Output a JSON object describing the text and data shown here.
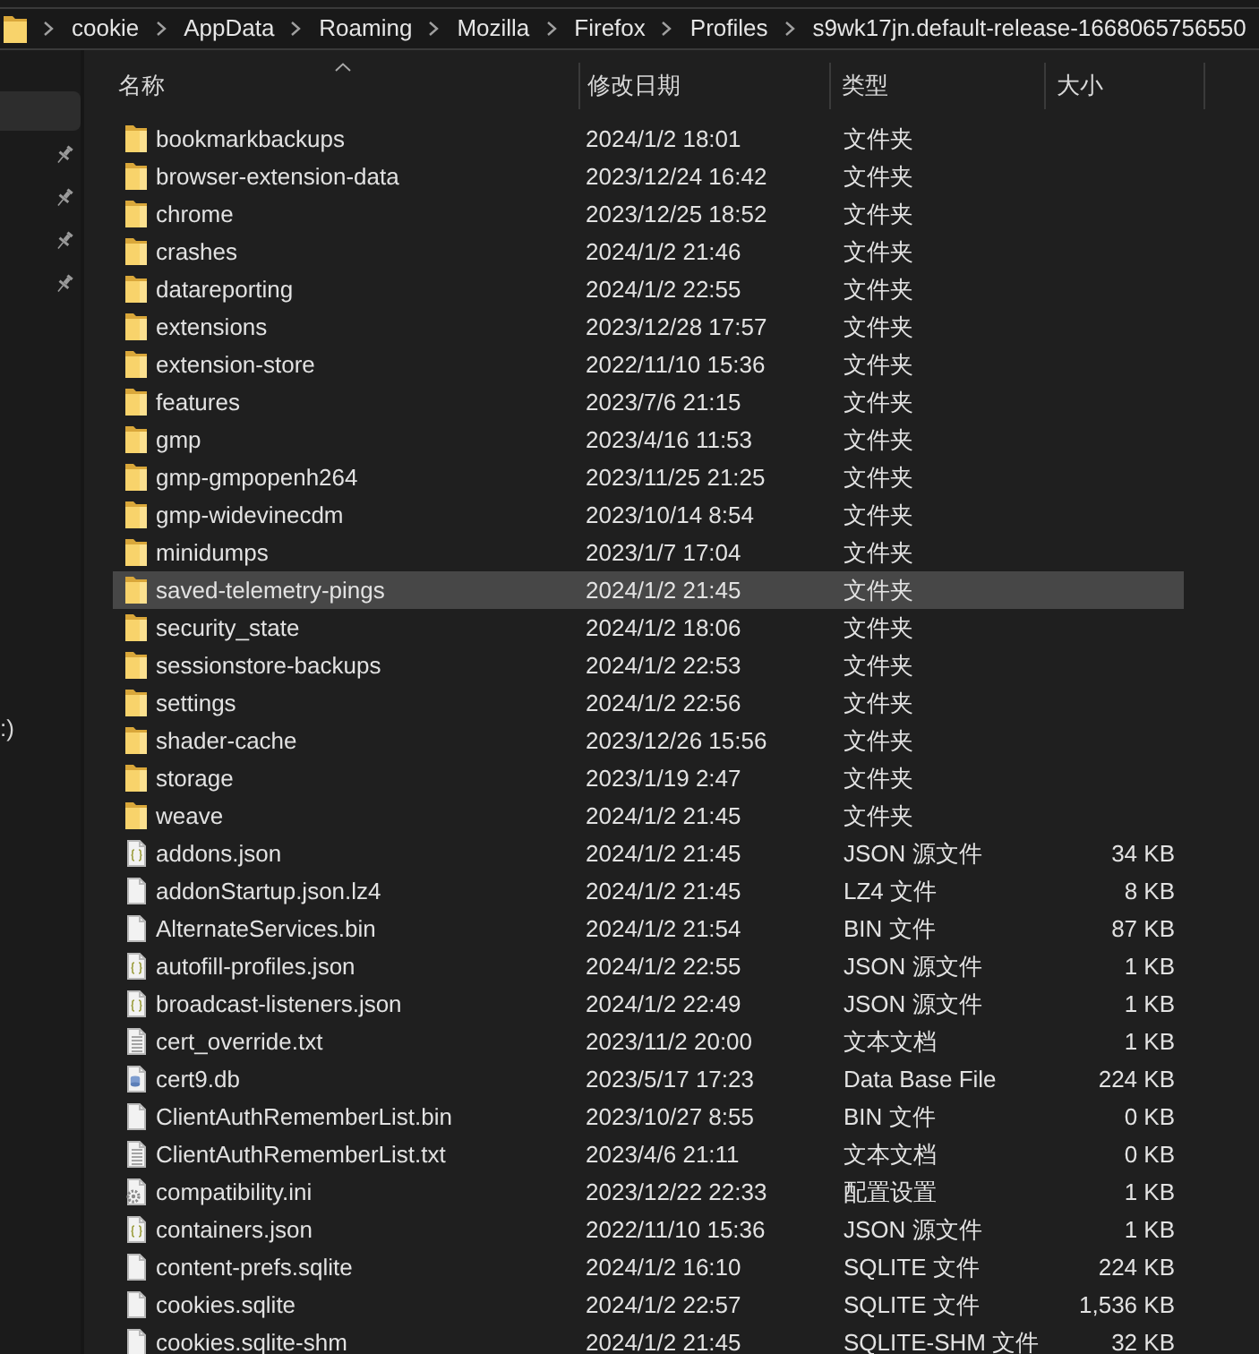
{
  "address_bar": {
    "path": [
      "cookie",
      "AppData",
      "Roaming",
      "Mozilla",
      "Firefox",
      "Profiles",
      "s9wk17jn.default-release-1668065756550"
    ]
  },
  "sidebar": {
    "items": [
      {
        "selected": true,
        "pinned": false
      },
      {
        "selected": false,
        "pinned": true
      },
      {
        "selected": false,
        "pinned": true
      },
      {
        "selected": false,
        "pinned": true
      },
      {
        "selected": false,
        "pinned": true
      }
    ],
    "drive": {
      "label": ":)",
      "selected": false
    }
  },
  "file_list": {
    "columns": [
      {
        "label": "名称",
        "sorted": true
      },
      {
        "label": "修改日期",
        "sorted": false
      },
      {
        "label": "类型",
        "sorted": false
      },
      {
        "label": "大小",
        "sorted": false
      }
    ],
    "rows": [
      {
        "kind": "folder",
        "name": "bookmarkbackups",
        "modified": "2024/1/2 18:01",
        "type": "文件夹",
        "selected": false
      },
      {
        "kind": "folder",
        "name": "browser-extension-data",
        "modified": "2023/12/24 16:42",
        "type": "文件夹",
        "selected": false
      },
      {
        "kind": "folder",
        "name": "chrome",
        "modified": "2023/12/25 18:52",
        "type": "文件夹",
        "selected": false
      },
      {
        "kind": "folder",
        "name": "crashes",
        "modified": "2024/1/2 21:46",
        "type": "文件夹",
        "selected": false
      },
      {
        "kind": "folder",
        "name": "datareporting",
        "modified": "2024/1/2 22:55",
        "type": "文件夹",
        "selected": false
      },
      {
        "kind": "folder",
        "name": "extensions",
        "modified": "2023/12/28 17:57",
        "type": "文件夹",
        "selected": false
      },
      {
        "kind": "folder",
        "name": "extension-store",
        "modified": "2022/11/10 15:36",
        "type": "文件夹",
        "selected": false
      },
      {
        "kind": "folder",
        "name": "features",
        "modified": "2023/7/6 21:15",
        "type": "文件夹",
        "selected": false
      },
      {
        "kind": "folder",
        "name": "gmp",
        "modified": "2023/4/16 11:53",
        "type": "文件夹",
        "selected": false
      },
      {
        "kind": "folder",
        "name": "gmp-gmpopenh264",
        "modified": "2023/11/25 21:25",
        "type": "文件夹",
        "selected": false
      },
      {
        "kind": "folder",
        "name": "gmp-widevinecdm",
        "modified": "2023/10/14 8:54",
        "type": "文件夹",
        "selected": false
      },
      {
        "kind": "folder",
        "name": "minidumps",
        "modified": "2023/1/7 17:04",
        "type": "文件夹",
        "selected": false
      },
      {
        "kind": "folder",
        "name": "saved-telemetry-pings",
        "modified": "2024/1/2 21:45",
        "type": "文件夹",
        "selected": true
      },
      {
        "kind": "folder",
        "name": "security_state",
        "modified": "2024/1/2 18:06",
        "type": "文件夹",
        "selected": false
      },
      {
        "kind": "folder",
        "name": "sessionstore-backups",
        "modified": "2024/1/2 22:53",
        "type": "文件夹",
        "selected": false
      },
      {
        "kind": "folder",
        "name": "settings",
        "modified": "2024/1/2 22:56",
        "type": "文件夹",
        "selected": false
      },
      {
        "kind": "folder",
        "name": "shader-cache",
        "modified": "2023/12/26 15:56",
        "type": "文件夹",
        "selected": false
      },
      {
        "kind": "folder",
        "name": "storage",
        "modified": "2023/1/19 2:47",
        "type": "文件夹",
        "selected": false
      },
      {
        "kind": "folder",
        "name": "weave",
        "modified": "2024/1/2 21:45",
        "type": "文件夹",
        "selected": false
      },
      {
        "kind": "json",
        "name": "addons.json",
        "modified": "2024/1/2 21:45",
        "type": "JSON 源文件",
        "size": "34 KB",
        "selected": false
      },
      {
        "kind": "blank",
        "name": "addonStartup.json.lz4",
        "modified": "2024/1/2 21:45",
        "type": "LZ4 文件",
        "size": "8 KB",
        "selected": false
      },
      {
        "kind": "blank",
        "name": "AlternateServices.bin",
        "modified": "2024/1/2 21:54",
        "type": "BIN 文件",
        "size": "87 KB",
        "selected": false
      },
      {
        "kind": "json",
        "name": "autofill-profiles.json",
        "modified": "2024/1/2 22:55",
        "type": "JSON 源文件",
        "size": "1 KB",
        "selected": false
      },
      {
        "kind": "json",
        "name": "broadcast-listeners.json",
        "modified": "2024/1/2 22:49",
        "type": "JSON 源文件",
        "size": "1 KB",
        "selected": false
      },
      {
        "kind": "text",
        "name": "cert_override.txt",
        "modified": "2023/11/2 20:00",
        "type": "文本文档",
        "size": "1 KB",
        "selected": false
      },
      {
        "kind": "database",
        "name": "cert9.db",
        "modified": "2023/5/17 17:23",
        "type": "Data Base File",
        "size": "224 KB",
        "selected": false
      },
      {
        "kind": "blank",
        "name": "ClientAuthRememberList.bin",
        "modified": "2023/10/27 8:55",
        "type": "BIN 文件",
        "size": "0 KB",
        "selected": false
      },
      {
        "kind": "text",
        "name": "ClientAuthRememberList.txt",
        "modified": "2023/4/6 21:11",
        "type": "文本文档",
        "size": "0 KB",
        "selected": false
      },
      {
        "kind": "settings",
        "name": "compatibility.ini",
        "modified": "2023/12/22 22:33",
        "type": "配置设置",
        "size": "1 KB",
        "selected": false
      },
      {
        "kind": "json",
        "name": "containers.json",
        "modified": "2022/11/10 15:36",
        "type": "JSON 源文件",
        "size": "1 KB",
        "selected": false
      },
      {
        "kind": "blank",
        "name": "content-prefs.sqlite",
        "modified": "2024/1/2 16:10",
        "type": "SQLITE 文件",
        "size": "224 KB",
        "selected": false
      },
      {
        "kind": "blank",
        "name": "cookies.sqlite",
        "modified": "2024/1/2 22:57",
        "type": "SQLITE 文件",
        "size": "1,536 KB",
        "selected": false
      },
      {
        "kind": "blank",
        "name": "cookies.sqlite-shm",
        "modified": "2024/1/2 21:45",
        "type": "SQLITE-SHM 文件",
        "size": "32 KB",
        "selected": false
      }
    ]
  }
}
